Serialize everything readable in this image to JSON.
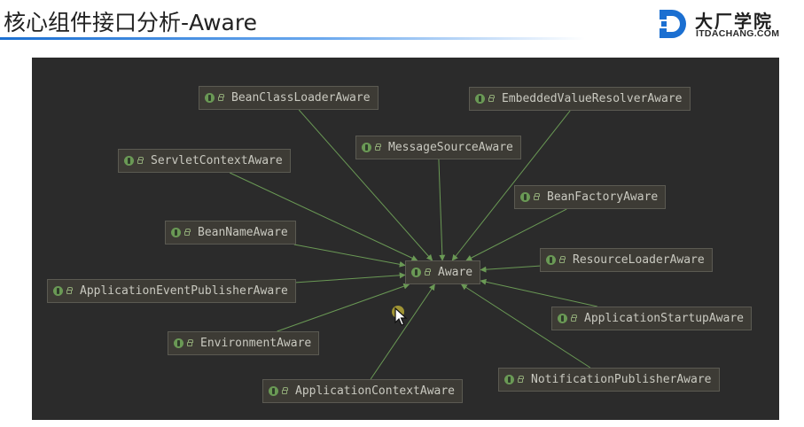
{
  "slide": {
    "title": "核心组件接口分析-Aware"
  },
  "brand": {
    "name_cn": "大厂学院",
    "name_en": "ITDACHANG.COM",
    "accent_color": "#1b6fd1"
  },
  "diagram": {
    "background_color": "#2b2b2b",
    "node_color": "#3d3b35",
    "edge_color": "#6a9955",
    "interface_icon": "interface-icon",
    "nodes": {
      "aware": "Aware",
      "bean_class_loader_aware": "BeanClassLoaderAware",
      "embedded_value_resolver_aware": "EmbeddedValueResolverAware",
      "message_source_aware": "MessageSourceAware",
      "servlet_context_aware": "ServletContextAware",
      "bean_factory_aware": "BeanFactoryAware",
      "bean_name_aware": "BeanNameAware",
      "resource_loader_aware": "ResourceLoaderAware",
      "application_event_publisher_aware": "ApplicationEventPublisherAware",
      "application_startup_aware": "ApplicationStartupAware",
      "environment_aware": "EnvironmentAware",
      "notification_publisher_aware": "NotificationPublisherAware",
      "application_context_aware": "ApplicationContextAware"
    },
    "edges": [
      {
        "from": "bean_class_loader_aware",
        "to": "aware"
      },
      {
        "from": "embedded_value_resolver_aware",
        "to": "aware"
      },
      {
        "from": "message_source_aware",
        "to": "aware"
      },
      {
        "from": "servlet_context_aware",
        "to": "aware"
      },
      {
        "from": "bean_factory_aware",
        "to": "aware"
      },
      {
        "from": "bean_name_aware",
        "to": "aware"
      },
      {
        "from": "resource_loader_aware",
        "to": "aware"
      },
      {
        "from": "application_event_publisher_aware",
        "to": "aware"
      },
      {
        "from": "application_startup_aware",
        "to": "aware"
      },
      {
        "from": "environment_aware",
        "to": "aware"
      },
      {
        "from": "notification_publisher_aware",
        "to": "aware"
      },
      {
        "from": "application_context_aware",
        "to": "aware"
      }
    ]
  }
}
